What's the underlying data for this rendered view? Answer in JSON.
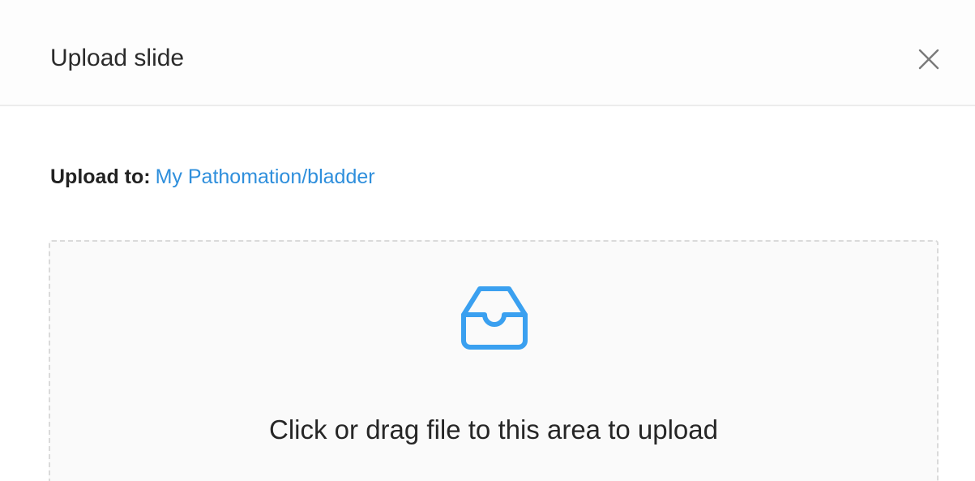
{
  "modal": {
    "title": "Upload slide",
    "close_icon": "close-icon"
  },
  "upload_to": {
    "label": "Upload to:",
    "path": "My Pathomation/bladder"
  },
  "dropzone": {
    "icon": "inbox-icon",
    "text": "Click or drag file to this area to upload"
  },
  "colors": {
    "accent": "#2f8fdc",
    "icon": "#3aa0f0",
    "border": "#dadada",
    "dropzone_bg": "#fafafa"
  }
}
